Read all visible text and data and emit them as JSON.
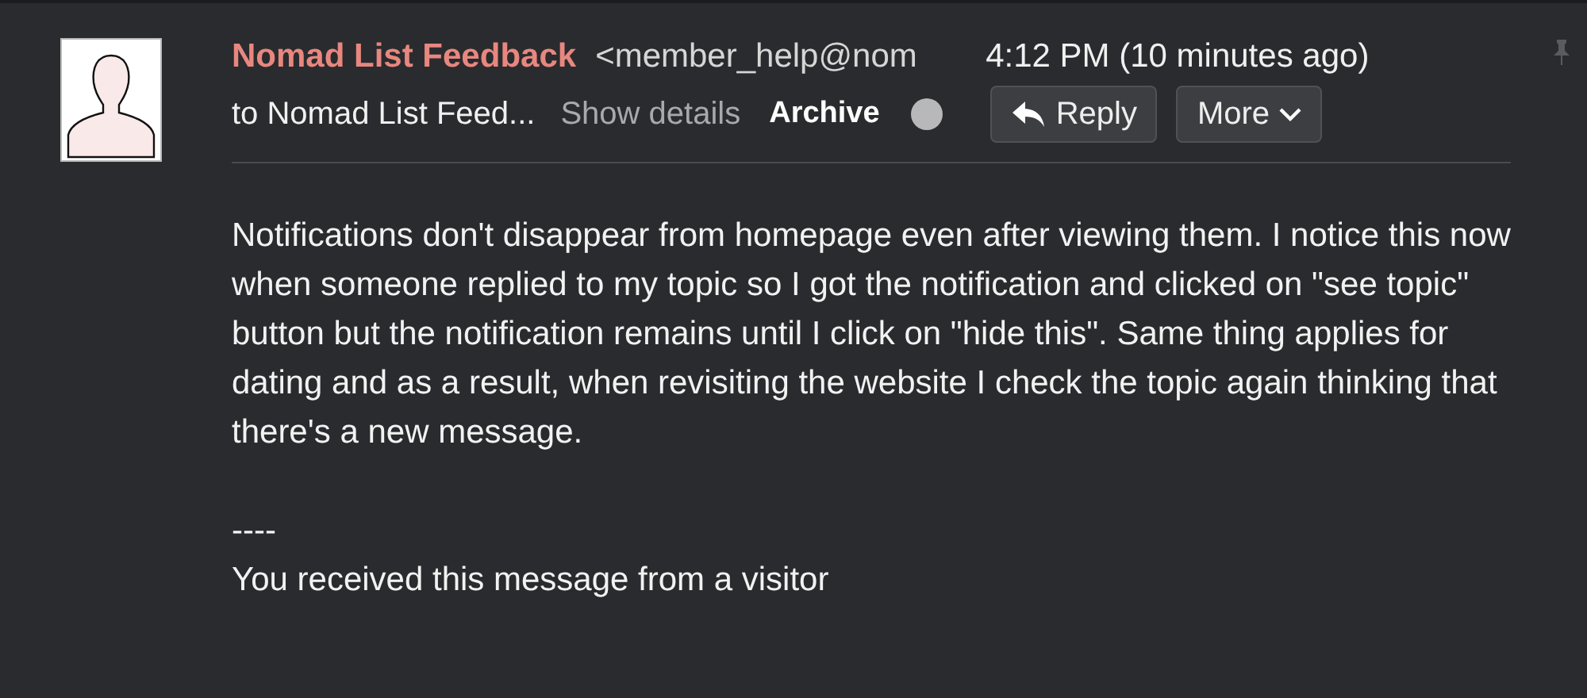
{
  "message": {
    "sender_name": "Nomad List Feedback",
    "sender_address": "<member_help@nom",
    "time": "4:12 PM (10 minutes ago)",
    "recipient": "to Nomad List Feed...",
    "show_details": "Show details",
    "archive": "Archive",
    "buttons": [
      {
        "kind": "reply",
        "label": "Reply"
      },
      {
        "kind": "more",
        "label": "More"
      }
    ],
    "body": [
      "Notifications don't disappear from homepage even after viewing them. I notice this now when someone replied to my topic so I got the notification and clicked on \"see topic\" button but the notification remains until I click on \"hide this\". Same thing applies for dating and as a result, when revisiting the website I check the topic again thinking that there's a new message."
    ],
    "signature": [
      "----",
      "You received this message from a visitor"
    ]
  }
}
